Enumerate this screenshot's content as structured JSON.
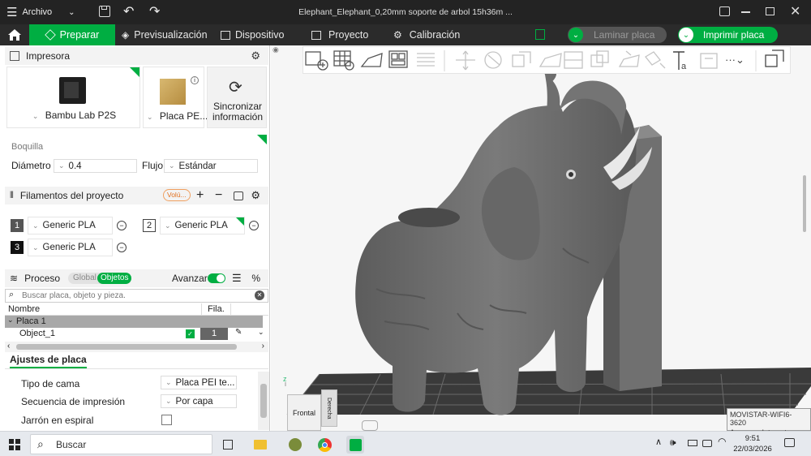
{
  "titlebar": {
    "menu_label": "Archivo",
    "title": "Elephant_Elephant_0,20mm soporte de arbol 15h36m ..."
  },
  "nav": {
    "tabs": [
      {
        "label": "Preparar"
      },
      {
        "label": "Previsualización"
      },
      {
        "label": "Dispositivo"
      },
      {
        "label": "Proyecto"
      },
      {
        "label": "Calibración"
      }
    ],
    "slice_label": "Laminar placa",
    "print_label": "Imprimir placa"
  },
  "printer": {
    "header": "Impresora",
    "printer_name": "Bambu Lab P2S",
    "plate_name": "Placa PE...",
    "sync_line1": "Sincronizar",
    "sync_line2": "información",
    "nozzle_label": "Boquilla",
    "diameter_label": "Diámetro",
    "diameter_value": "0.4",
    "flow_label": "Flujo",
    "flow_value": "Estándar"
  },
  "filaments": {
    "header": "Filamentos del proyecto",
    "badge": "Volú...",
    "items": [
      {
        "num": "1",
        "name": "Generic PLA",
        "color": "#555555"
      },
      {
        "num": "2",
        "name": "Generic PLA",
        "color": "#ffffff"
      },
      {
        "num": "3",
        "name": "Generic PLA",
        "color": "#111111"
      }
    ]
  },
  "process": {
    "header": "Proceso",
    "global_label": "Global",
    "objects_label": "Objetos",
    "advanced_label": "Avanzar",
    "advanced_on": true,
    "search_placeholder": "Buscar placa, objeto y pieza.",
    "col_name": "Nombre",
    "col_fila": "Fila.",
    "plate_row": "Placa 1",
    "object_row": "Object_1",
    "object_filament": "1"
  },
  "plate_settings": {
    "tab": "Ajustes de placa",
    "bed_type_label": "Tipo de cama",
    "bed_type_value": "Placa PEI te...",
    "sequence_label": "Secuencia de impresión",
    "sequence_value": "Por capa",
    "spiral_label": "Jarrón en espiral"
  },
  "viewport": {
    "cube_front": "Frontal",
    "cube_right": "Derecha",
    "axis_z": "z"
  },
  "taskbar": {
    "search_label": "Buscar",
    "time": "9:51",
    "date": "22/03/2026",
    "wifi_tooltip_line1": "MOVISTAR-WIFI6-3620",
    "wifi_tooltip_line2": "Acceso a Internet"
  },
  "colors": {
    "accent": "#00ae42",
    "titlebar_bg": "#232323",
    "navbar_bg": "#2b2b2b",
    "model": "#6e6e6e"
  }
}
